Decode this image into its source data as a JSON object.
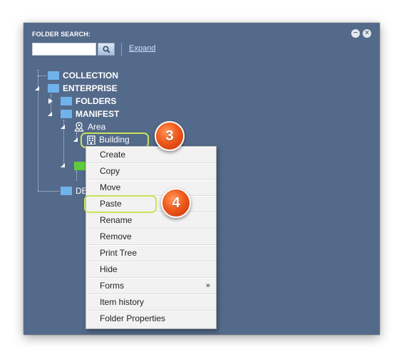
{
  "panel": {
    "title": "FOLDER SEARCH:",
    "search_placeholder": "",
    "expand_link": "Expand",
    "close_glyph": "×",
    "minimize_glyph": "−"
  },
  "tree": {
    "collection": "COLLECTION",
    "enterprise": "ENTERPRISE",
    "folders": "FOLDERS",
    "manifest": "MANIFEST",
    "area": "Area",
    "building": "Building",
    "truncated_label": "DE"
  },
  "context_menu": {
    "items": [
      "Create",
      "Copy",
      "Move",
      "Paste",
      "Rename",
      "Remove",
      "Print Tree",
      "Hide",
      "Forms",
      "Item history",
      "Folder Properties"
    ],
    "submenu_arrow": "»"
  },
  "annotations": {
    "step_3": "3",
    "step_4": "4"
  },
  "colors": {
    "panel_bg": "#546a8a",
    "folder_blue": "#6fb3ea",
    "folder_green": "#5ecb3e",
    "highlight": "#c7e35a",
    "badge": "#f05a1c"
  },
  "icons": [
    "search-icon",
    "minimize-icon",
    "close-icon",
    "folder-icon",
    "map-pin-icon",
    "building-icon",
    "expand-triangle-icon",
    "collapse-triangle-icon"
  ]
}
